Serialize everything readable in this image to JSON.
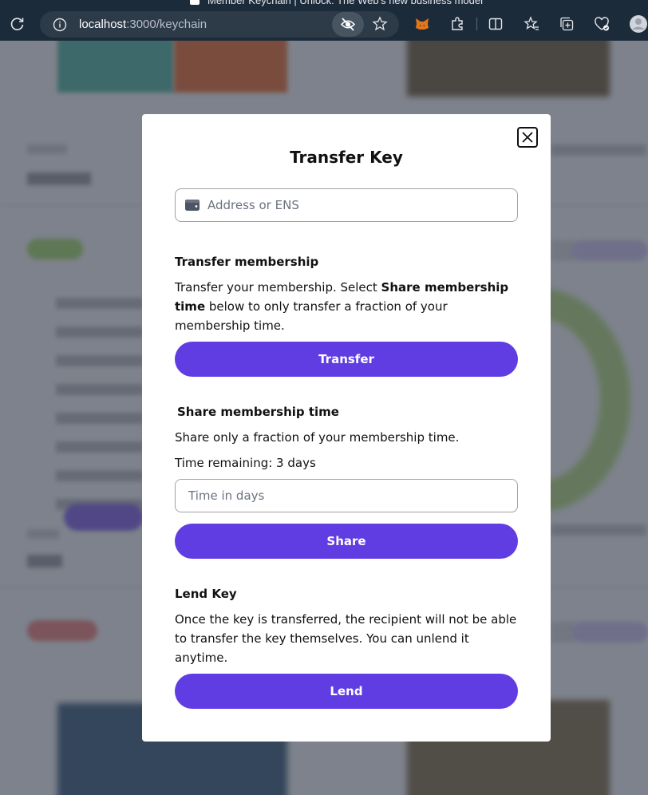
{
  "browser": {
    "tab_title": "Member Keychain | Unlock: The Web's new business model",
    "url_host": "localhost",
    "url_path": ":3000/keychain"
  },
  "modal": {
    "title": "Transfer Key",
    "address_placeholder": "Address or ENS",
    "transfer_section": {
      "title": "Transfer membership",
      "text_before": "Transfer your membership. Select ",
      "text_bold": "Share membership time",
      "text_after": " below to only transfer a fraction of your membership time.",
      "button_label": "Transfer"
    },
    "share_section": {
      "title": "Share membership time",
      "description": "Share only a fraction of your membership time.",
      "time_remaining": "Time remaining: 3 days",
      "days_placeholder": "Time in days",
      "button_label": "Share"
    },
    "lend_section": {
      "title": "Lend Key",
      "description": "Once the key is transferred, the recipient will not be able to transfer the key themselves. You can unlend it anytime.",
      "button_label": "Lend"
    }
  }
}
